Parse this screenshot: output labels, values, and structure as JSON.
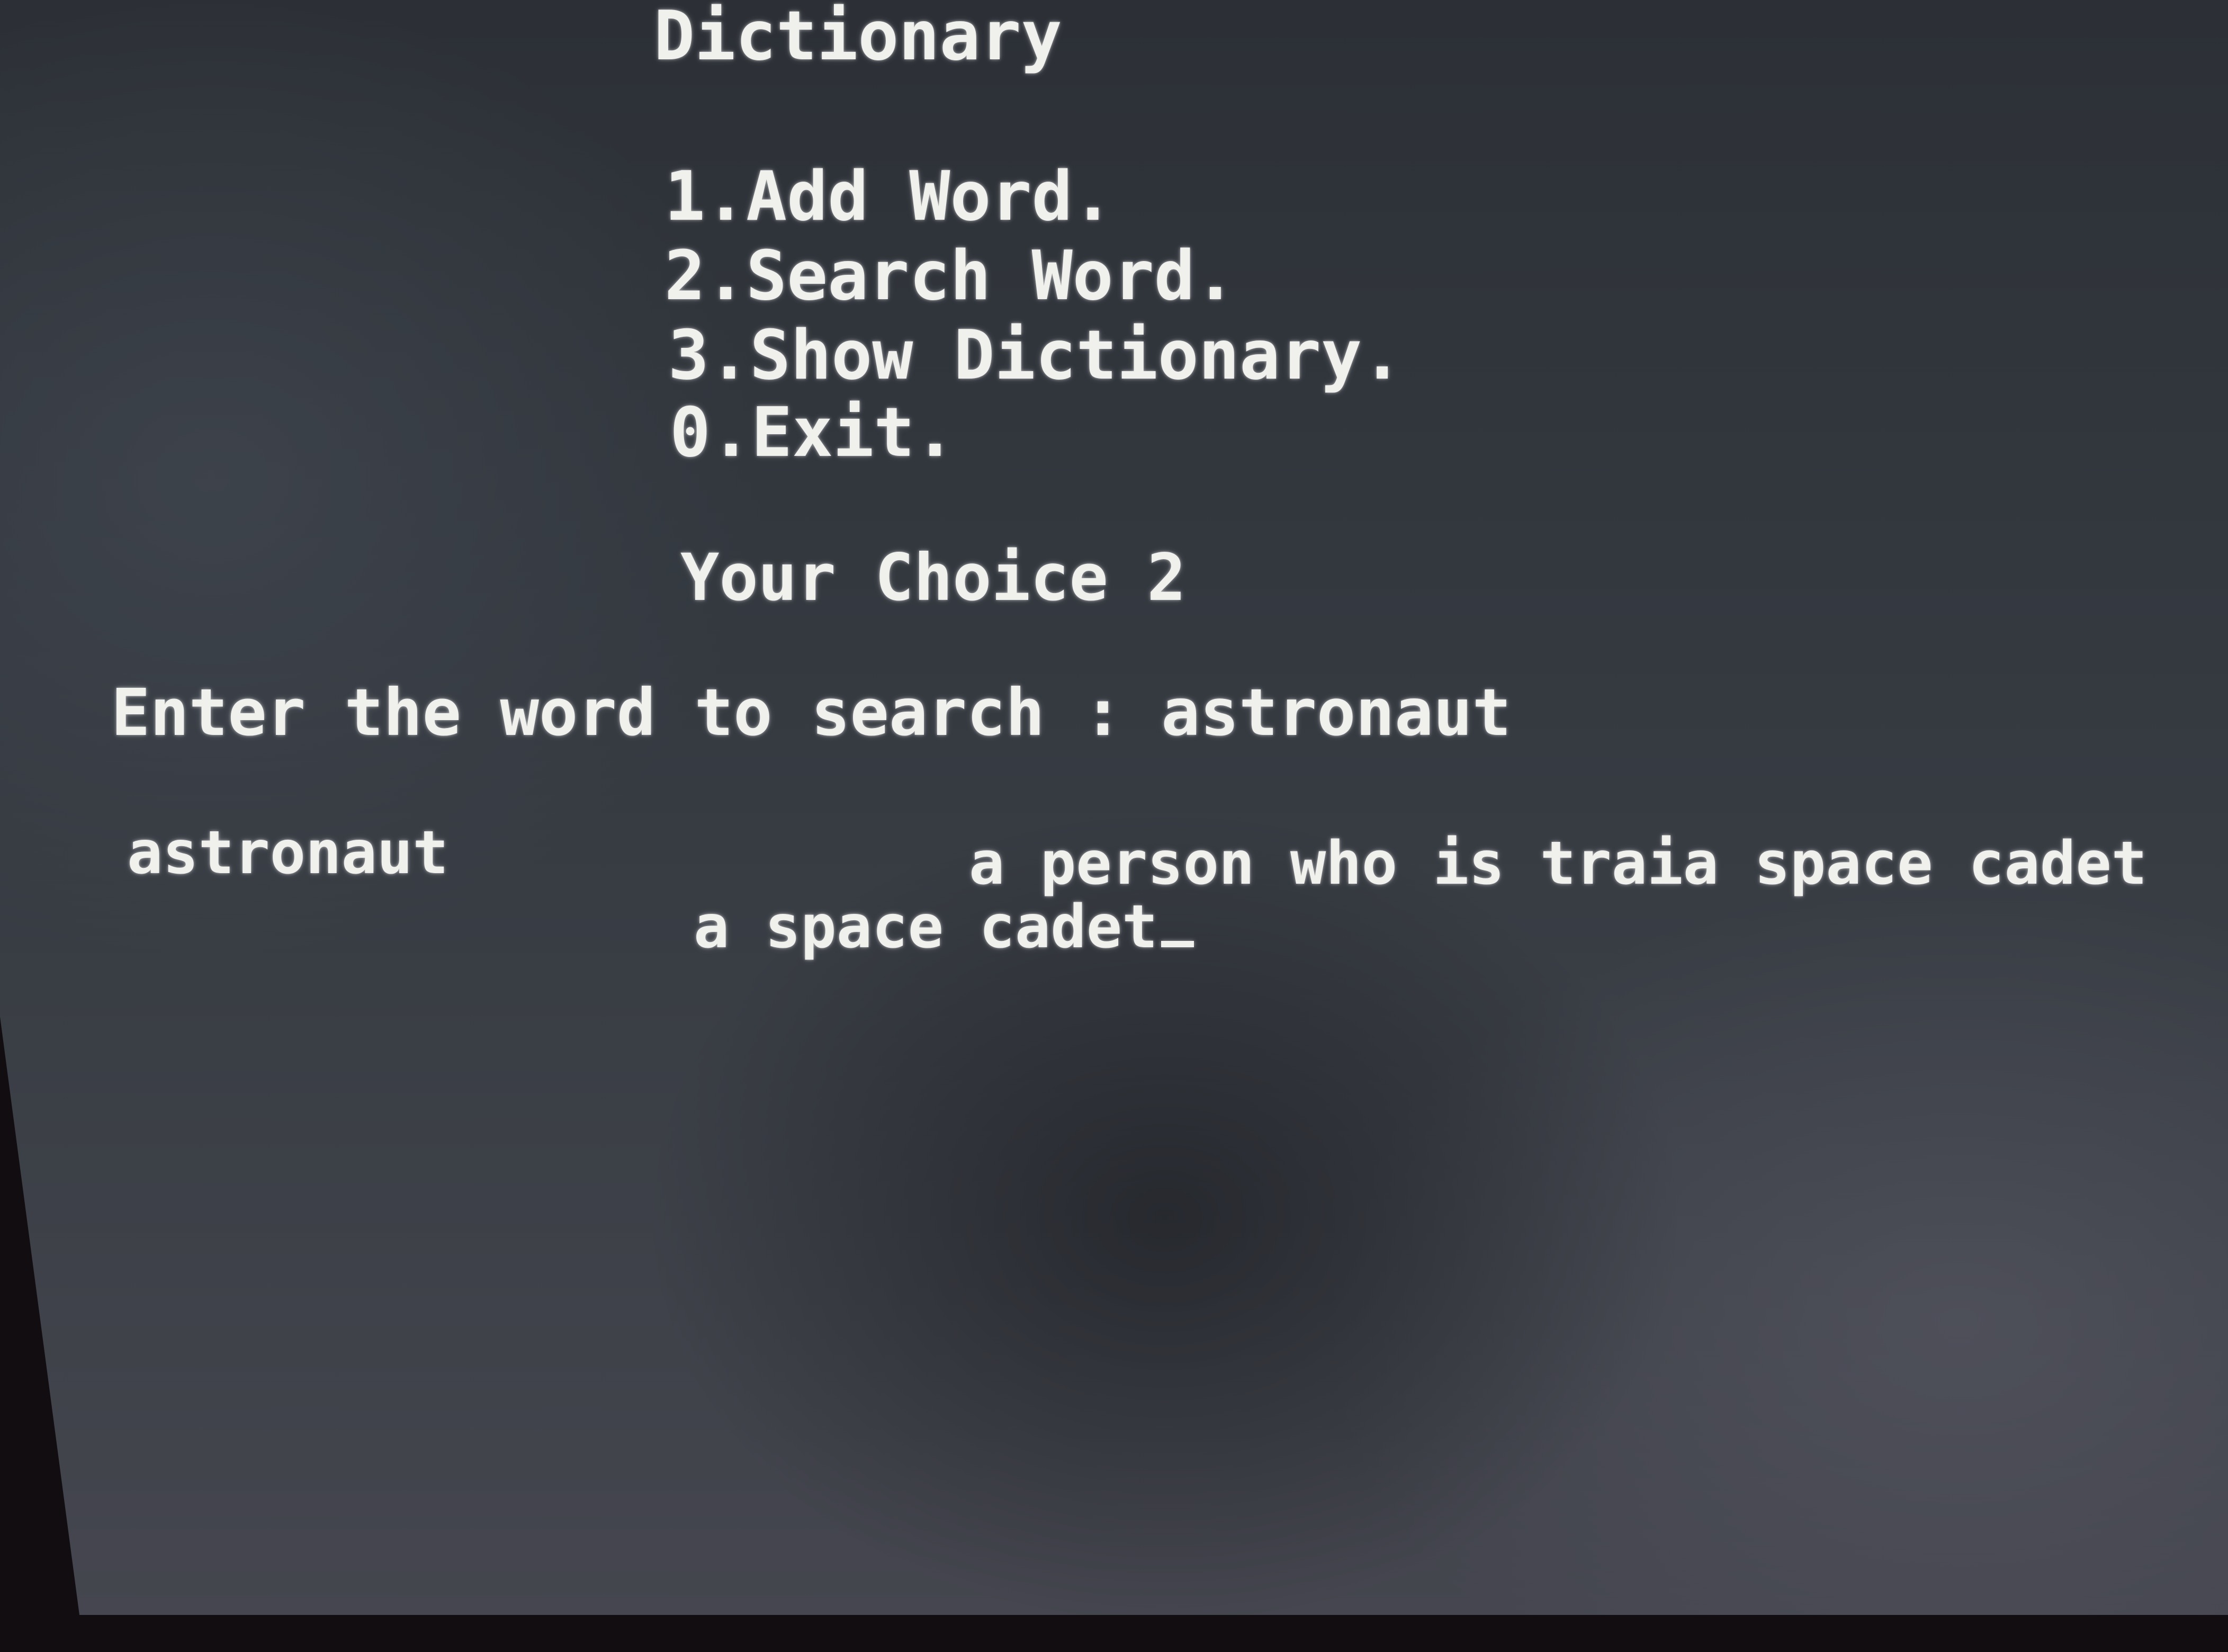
{
  "app": {
    "title": "Dictionary"
  },
  "menu": {
    "items": [
      {
        "label": "1.Add Word."
      },
      {
        "label": "2.Search Word."
      },
      {
        "label": "3.Show Dictionary."
      },
      {
        "label": "0.Exit."
      }
    ]
  },
  "choice": {
    "label": "Your Choice",
    "value": "2"
  },
  "search": {
    "prompt": "Enter the word to search :",
    "value": "astronaut"
  },
  "result": {
    "word": "astronaut",
    "definition_line1": "a person who is traia space cadet",
    "definition_line2": "a space cadet"
  },
  "colors": {
    "screen_background": "#33383f",
    "text": "#f0f0ec"
  }
}
